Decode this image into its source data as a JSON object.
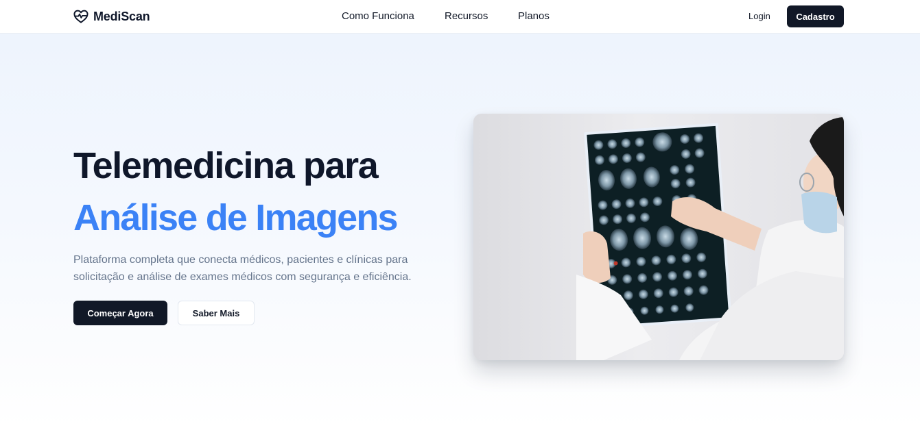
{
  "brand": {
    "name": "MediScan",
    "icon": "heart-pulse-icon"
  },
  "nav": {
    "items": [
      "Como Funciona",
      "Recursos",
      "Planos"
    ],
    "login_label": "Login",
    "signup_label": "Cadastro"
  },
  "hero": {
    "title_line1": "Telemedicina para",
    "title_line2": "Análise de Imagens",
    "description": "Plataforma completa que conecta médicos, pacientes e clínicas para solicitação e análise de exames médicos com segurança e eficiência.",
    "primary_cta": "Começar Agora",
    "secondary_cta": "Saber Mais",
    "image_alt": "Doctor examining a brain MRI scan film"
  },
  "colors": {
    "primary_dark": "#111827",
    "accent_blue": "#3b82f6",
    "text_muted": "#64748b",
    "hero_bg": "#eef4fd"
  }
}
